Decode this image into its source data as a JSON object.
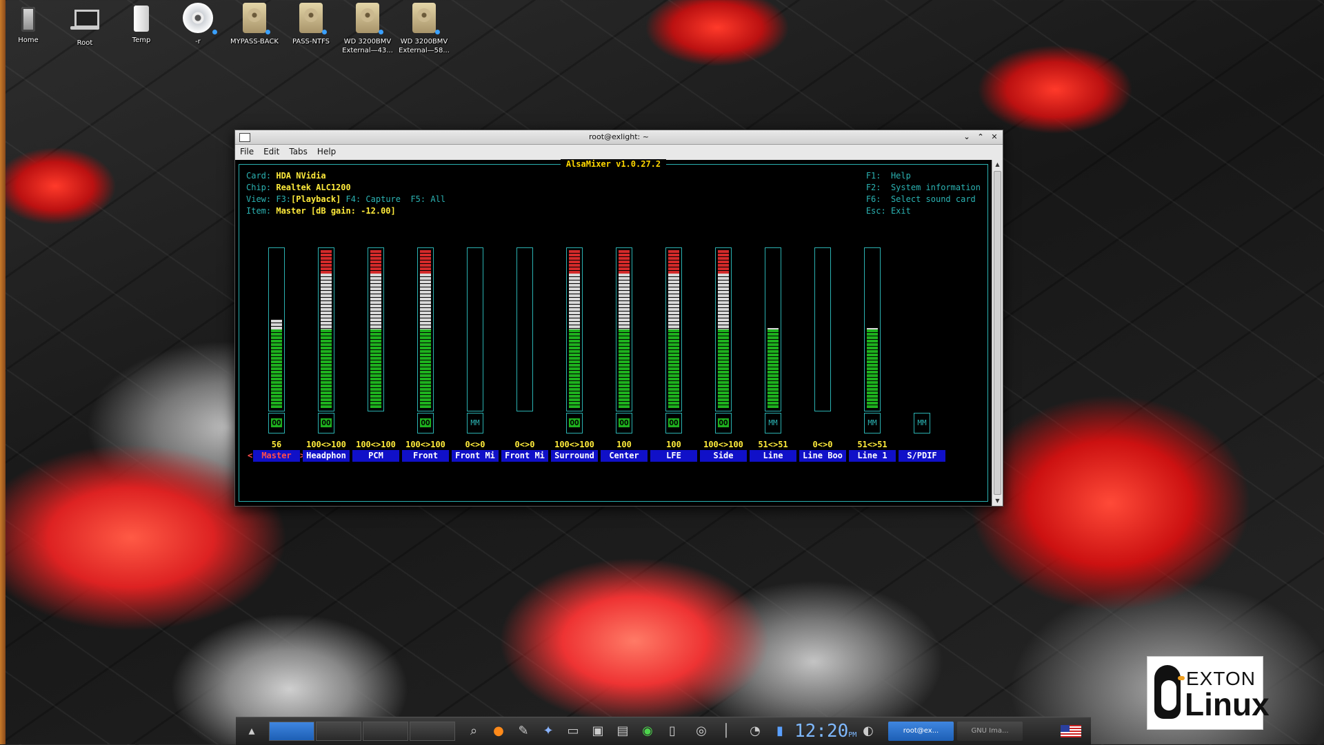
{
  "desktop": {
    "icons": [
      {
        "label": "Home",
        "icon": "trash-icon"
      },
      {
        "label": "Root",
        "icon": "laptop-icon"
      },
      {
        "label": "Temp",
        "icon": "usb-drive-icon"
      },
      {
        "label": "-r",
        "icon": "cd-icon"
      },
      {
        "label": "MYPASS-BACK",
        "icon": "hard-drive-icon"
      },
      {
        "label": "PASS-NTFS",
        "icon": "hard-drive-icon"
      },
      {
        "label": "WD 3200BMV External—43...",
        "icon": "hard-drive-icon"
      },
      {
        "label": "WD 3200BMV External—58...",
        "icon": "hard-drive-icon"
      }
    ]
  },
  "window": {
    "title": "root@exlight: ~",
    "menu": [
      "File",
      "Edit",
      "Tabs",
      "Help"
    ]
  },
  "alsamixer": {
    "title": "AlsaMixer v1.0.27.2",
    "info": {
      "card_key": "Card:",
      "card": "HDA NVidia",
      "chip_key": "Chip:",
      "chip": "Realtek ALC1200",
      "view_key": "View:",
      "view_f3": "F3:",
      "view_playback": "[Playback]",
      "view_rest": " F4: Capture  F5: All",
      "item_key": "Item:",
      "item": "Master [dB gain: -12.00]"
    },
    "help": [
      "F1:  Help",
      "F2:  System information",
      "F6:  Select sound card",
      "Esc: Exit"
    ],
    "selected_marker_left": "<",
    "selected_marker_right": ">",
    "channels": [
      {
        "name": "Master",
        "value": "56",
        "level": 0.56,
        "mute": "OO",
        "selected": true
      },
      {
        "name": "Headphon",
        "value": "100<>100",
        "level": 1.0,
        "mute": "OO"
      },
      {
        "name": "PCM",
        "value": "100<>100",
        "level": 1.0,
        "mute": ""
      },
      {
        "name": "Front",
        "value": "100<>100",
        "level": 1.0,
        "mute": "OO"
      },
      {
        "name": "Front Mi",
        "value": "0<>0",
        "level": 0,
        "mute": "MM"
      },
      {
        "name": "Front Mi",
        "value": "0<>0",
        "level": 0,
        "mute": ""
      },
      {
        "name": "Surround",
        "value": "100<>100",
        "level": 1.0,
        "mute": "OO"
      },
      {
        "name": "Center",
        "value": "100",
        "level": 1.0,
        "mute": "OO"
      },
      {
        "name": "LFE",
        "value": "100",
        "level": 1.0,
        "mute": "OO"
      },
      {
        "name": "Side",
        "value": "100<>100",
        "level": 1.0,
        "mute": "OO"
      },
      {
        "name": "Line",
        "value": "51<>51",
        "level": 0.51,
        "mute": "MM"
      },
      {
        "name": "Line Boo",
        "value": "0<>0",
        "level": 0,
        "mute": ""
      },
      {
        "name": "Line 1",
        "value": "51<>51",
        "level": 0.51,
        "mute": "MM"
      },
      {
        "name": "S/PDIF",
        "value": "",
        "level": null,
        "mute": "MM"
      }
    ]
  },
  "taskbar": {
    "clock": "12:20",
    "ampm": "PM",
    "tasks": [
      {
        "label": "root@ex...",
        "active": true
      },
      {
        "label": "GNU Ima...",
        "active": false
      }
    ]
  },
  "logo": {
    "line1": "EXTON",
    "line2": "Linux"
  },
  "colors": {
    "cyan": "#2bb3b3",
    "yellow": "#ffeb3b",
    "green": "#1eb11e",
    "red": "#d42a2a",
    "white": "#d8d8d8",
    "label_bg": "#1010c8"
  }
}
